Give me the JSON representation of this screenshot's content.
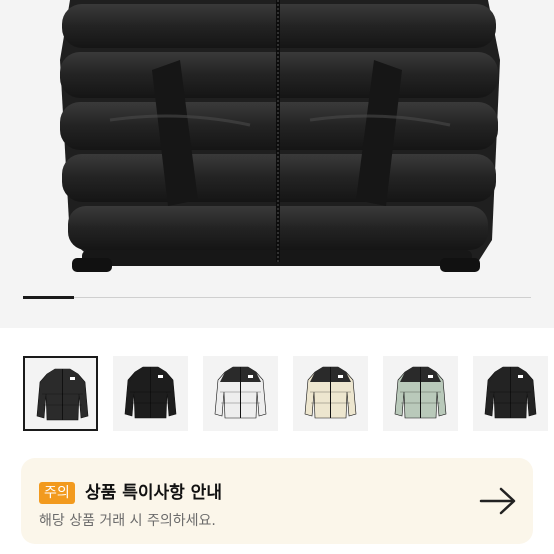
{
  "gallery": {
    "progress": 0.1,
    "thumbnails": [
      {
        "color": "#2b2b2b",
        "yoke": "#2b2b2b",
        "selected": true
      },
      {
        "color": "#1d1d1d",
        "yoke": "#1d1d1d",
        "selected": false
      },
      {
        "color": "#eeeeee",
        "yoke": "#2a2a2a",
        "selected": false
      },
      {
        "color": "#ede6cf",
        "yoke": "#2a2a2a",
        "selected": false
      },
      {
        "color": "#b9c9ba",
        "yoke": "#2a2a2a",
        "selected": false
      },
      {
        "color": "#232323",
        "yoke": "#232323",
        "selected": false
      }
    ]
  },
  "notice": {
    "badge": "주의",
    "title": "상품 특이사항 안내",
    "subtitle": "해당 상품 거래 시 주의하세요."
  },
  "colors": {
    "badge": "#f29a1e",
    "notice_bg": "#fbf6ea",
    "jacket": "#242424"
  }
}
